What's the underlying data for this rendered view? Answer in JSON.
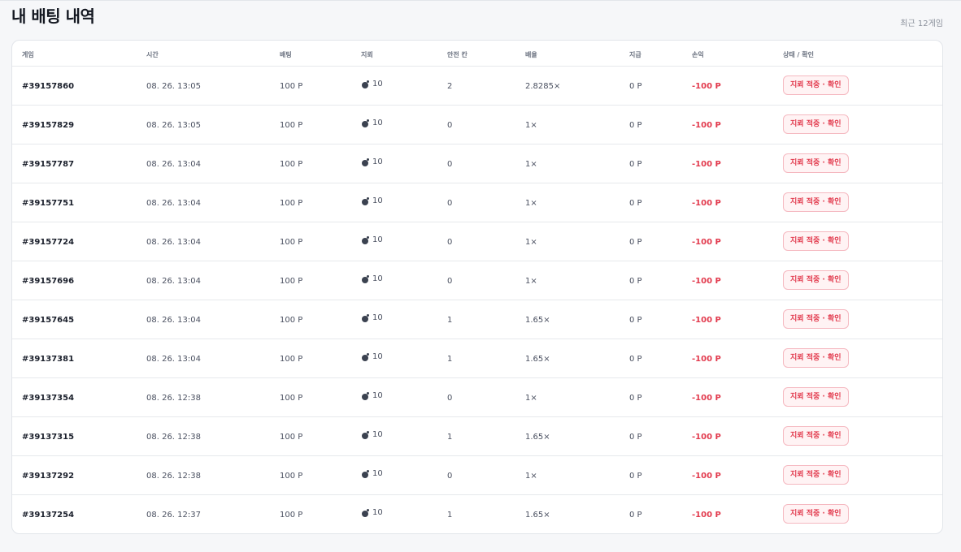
{
  "header": {
    "title": "내 배팅 내역",
    "recent": "최근 12게임"
  },
  "table": {
    "columns": [
      "게임",
      "시간",
      "배팅",
      "지뢰",
      "안전 칸",
      "배율",
      "지급",
      "손익",
      "상태 / 확인"
    ],
    "rows": [
      {
        "id": "#39157860",
        "time": "08. 26. 13:05",
        "bet": "100 P",
        "mines": "10",
        "safe": "2",
        "mult": "2.8285×",
        "payout": "0 P",
        "profit": "-100 P",
        "status": "지뢰 적중 · 확인"
      },
      {
        "id": "#39157829",
        "time": "08. 26. 13:05",
        "bet": "100 P",
        "mines": "10",
        "safe": "0",
        "mult": "1×",
        "payout": "0 P",
        "profit": "-100 P",
        "status": "지뢰 적중 · 확인"
      },
      {
        "id": "#39157787",
        "time": "08. 26. 13:04",
        "bet": "100 P",
        "mines": "10",
        "safe": "0",
        "mult": "1×",
        "payout": "0 P",
        "profit": "-100 P",
        "status": "지뢰 적중 · 확인"
      },
      {
        "id": "#39157751",
        "time": "08. 26. 13:04",
        "bet": "100 P",
        "mines": "10",
        "safe": "0",
        "mult": "1×",
        "payout": "0 P",
        "profit": "-100 P",
        "status": "지뢰 적중 · 확인"
      },
      {
        "id": "#39157724",
        "time": "08. 26. 13:04",
        "bet": "100 P",
        "mines": "10",
        "safe": "0",
        "mult": "1×",
        "payout": "0 P",
        "profit": "-100 P",
        "status": "지뢰 적중 · 확인"
      },
      {
        "id": "#39157696",
        "time": "08. 26. 13:04",
        "bet": "100 P",
        "mines": "10",
        "safe": "0",
        "mult": "1×",
        "payout": "0 P",
        "profit": "-100 P",
        "status": "지뢰 적중 · 확인"
      },
      {
        "id": "#39157645",
        "time": "08. 26. 13:04",
        "bet": "100 P",
        "mines": "10",
        "safe": "1",
        "mult": "1.65×",
        "payout": "0 P",
        "profit": "-100 P",
        "status": "지뢰 적중 · 확인"
      },
      {
        "id": "#39137381",
        "time": "08. 26. 13:04",
        "bet": "100 P",
        "mines": "10",
        "safe": "1",
        "mult": "1.65×",
        "payout": "0 P",
        "profit": "-100 P",
        "status": "지뢰 적중 · 확인"
      },
      {
        "id": "#39137354",
        "time": "08. 26. 12:38",
        "bet": "100 P",
        "mines": "10",
        "safe": "0",
        "mult": "1×",
        "payout": "0 P",
        "profit": "-100 P",
        "status": "지뢰 적중 · 확인"
      },
      {
        "id": "#39137315",
        "time": "08. 26. 12:38",
        "bet": "100 P",
        "mines": "10",
        "safe": "1",
        "mult": "1.65×",
        "payout": "0 P",
        "profit": "-100 P",
        "status": "지뢰 적중 · 확인"
      },
      {
        "id": "#39137292",
        "time": "08. 26. 12:38",
        "bet": "100 P",
        "mines": "10",
        "safe": "0",
        "mult": "1×",
        "payout": "0 P",
        "profit": "-100 P",
        "status": "지뢰 적중 · 확인"
      },
      {
        "id": "#39137254",
        "time": "08. 26. 12:37",
        "bet": "100 P",
        "mines": "10",
        "safe": "1",
        "mult": "1.65×",
        "payout": "0 P",
        "profit": "-100 P",
        "status": "지뢰 적중 · 확인"
      }
    ]
  },
  "icons": {
    "mine": "bomb-icon"
  },
  "colors": {
    "loss": "#e23b4e",
    "badge_bg": "#fff3f4",
    "badge_border": "#f5b8c0"
  }
}
